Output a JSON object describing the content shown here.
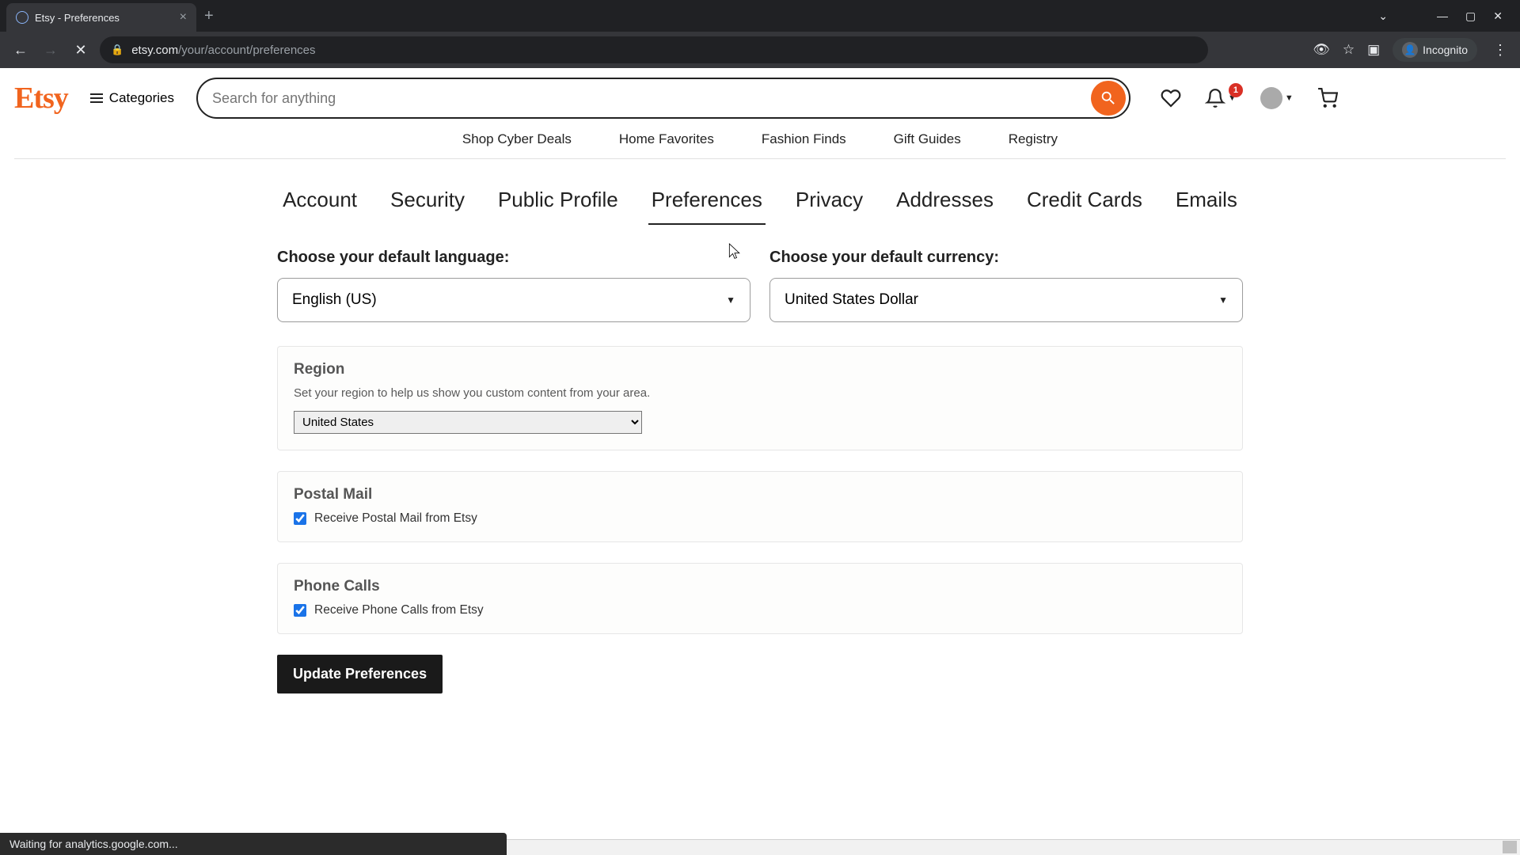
{
  "browser": {
    "tab_title": "Etsy - Preferences",
    "url_domain": "etsy.com",
    "url_path": "/your/account/preferences",
    "incognito_label": "Incognito",
    "status_text": "Waiting for analytics.google.com..."
  },
  "header": {
    "logo_text": "Etsy",
    "categories_label": "Categories",
    "search_placeholder": "Search for anything",
    "notification_count": "1",
    "promo_links": [
      "Shop Cyber Deals",
      "Home Favorites",
      "Fashion Finds",
      "Gift Guides",
      "Registry"
    ]
  },
  "settings": {
    "tabs": [
      "Account",
      "Security",
      "Public Profile",
      "Preferences",
      "Privacy",
      "Addresses",
      "Credit Cards",
      "Emails"
    ],
    "active_tab_index": 3,
    "language": {
      "label": "Choose your default language:",
      "value": "English (US)"
    },
    "currency": {
      "label": "Choose your default currency:",
      "value": "United States Dollar"
    },
    "region": {
      "title": "Region",
      "description": "Set your region to help us show you custom content from your area.",
      "value": "United States"
    },
    "postal_mail": {
      "title": "Postal Mail",
      "checkbox_label": "Receive Postal Mail from Etsy",
      "checked": true
    },
    "phone_calls": {
      "title": "Phone Calls",
      "checkbox_label": "Receive Phone Calls from Etsy",
      "checked": true
    },
    "submit_label": "Update Preferences"
  }
}
